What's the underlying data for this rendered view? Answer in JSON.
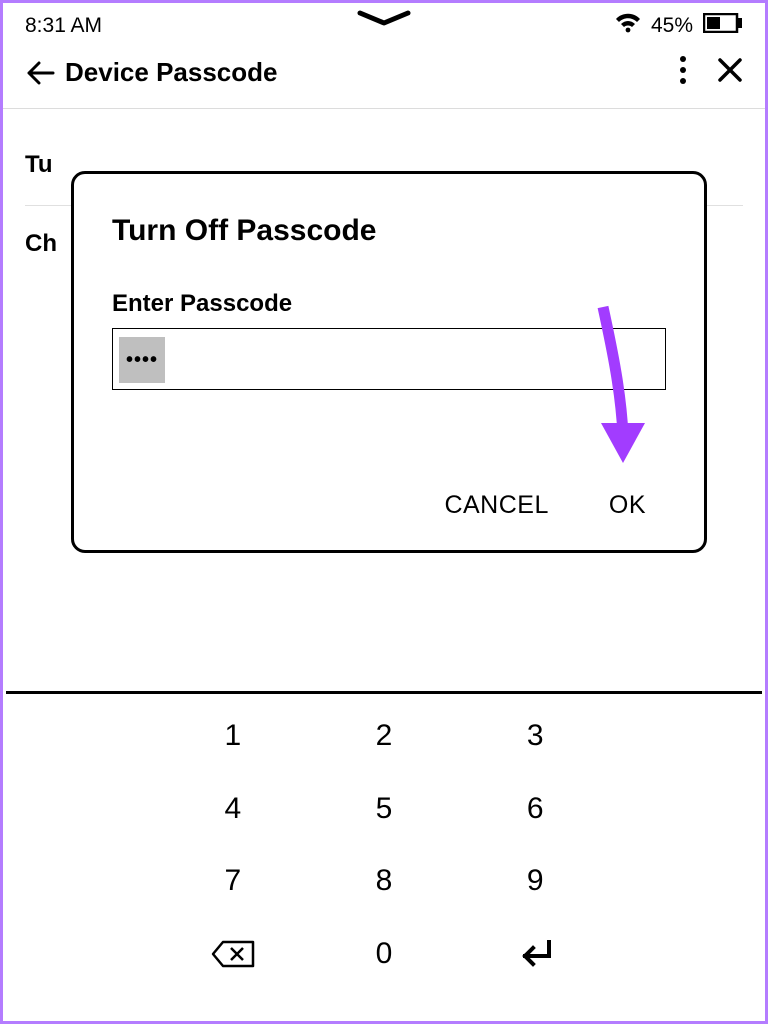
{
  "statusbar": {
    "time": "8:31 AM",
    "battery_pct": "45%"
  },
  "header": {
    "title": "Device Passcode"
  },
  "list": {
    "item1_partial": "Tu",
    "item2_partial": "Ch"
  },
  "dialog": {
    "title": "Turn Off Passcode",
    "label": "Enter Passcode",
    "masked_value": "••••",
    "cancel": "CANCEL",
    "ok": "OK"
  },
  "keypad": {
    "rows": [
      [
        "",
        "1",
        "2",
        "3",
        ""
      ],
      [
        "",
        "4",
        "5",
        "6",
        ""
      ],
      [
        "",
        "7",
        "8",
        "9",
        ""
      ],
      [
        "",
        "bksp",
        "0",
        "enter",
        ""
      ]
    ]
  }
}
